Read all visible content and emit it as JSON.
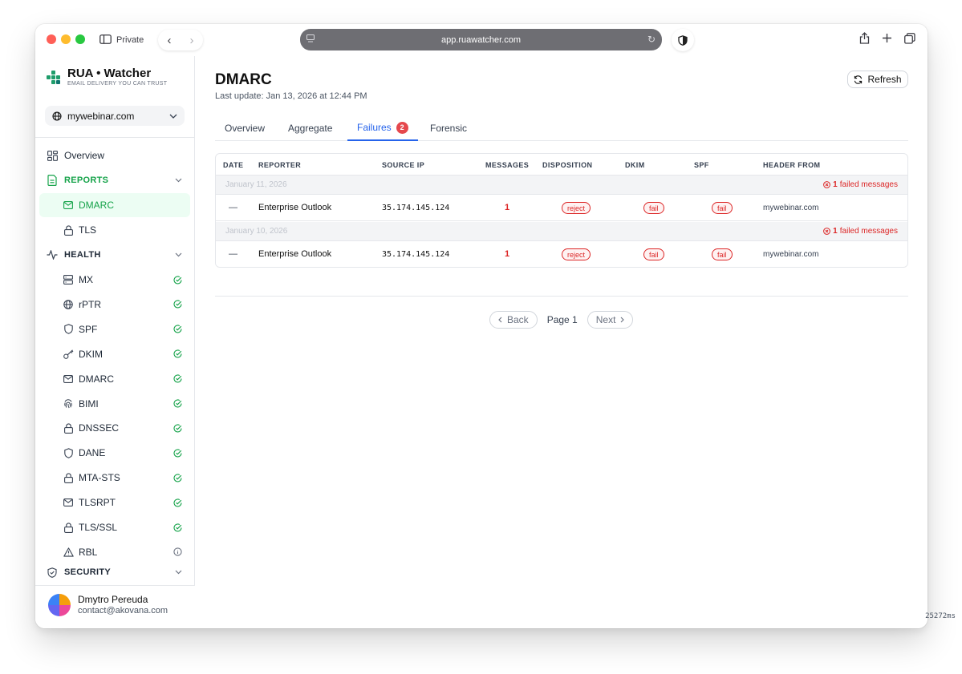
{
  "browser": {
    "private_label": "Private",
    "url": "app.ruawatcher.com"
  },
  "brand": {
    "name": "RUA • Watcher",
    "tagline": "EMAIL DELIVERY YOU CAN TRUST",
    "accent": "#16a34a"
  },
  "domain_select": {
    "value": "mywebinar.com"
  },
  "sidebar": {
    "overview": "Overview",
    "reports": "REPORTS",
    "dmarc_report": "DMARC",
    "tls_report": "TLS",
    "health": "HEALTH",
    "health_items": [
      {
        "label": "MX",
        "icon": "server-icon",
        "status": "ok"
      },
      {
        "label": "rPTR",
        "icon": "globe-icon",
        "status": "ok"
      },
      {
        "label": "SPF",
        "icon": "shield-icon",
        "status": "ok"
      },
      {
        "label": "DKIM",
        "icon": "key-icon",
        "status": "ok"
      },
      {
        "label": "DMARC",
        "icon": "mail-icon",
        "status": "ok"
      },
      {
        "label": "BIMI",
        "icon": "fingerprint-icon",
        "status": "ok"
      },
      {
        "label": "DNSSEC",
        "icon": "lock-icon",
        "status": "ok"
      },
      {
        "label": "DANE",
        "icon": "shield-icon",
        "status": "ok"
      },
      {
        "label": "MTA-STS",
        "icon": "lock-icon",
        "status": "ok"
      },
      {
        "label": "TLSRPT",
        "icon": "mail-icon",
        "status": "ok"
      },
      {
        "label": "TLS/SSL",
        "icon": "lock-icon",
        "status": "ok"
      },
      {
        "label": "RBL",
        "icon": "warning-icon",
        "status": "info"
      }
    ],
    "security": "SECURITY"
  },
  "user": {
    "name": "Dmytro Pereuda",
    "email": "contact@akovana.com"
  },
  "main": {
    "title": "DMARC",
    "last_update": "Last update: Jan 13, 2026 at 12:44 PM",
    "refresh_label": "Refresh",
    "tabs": [
      {
        "label": "Overview"
      },
      {
        "label": "Aggregate"
      },
      {
        "label": "Failures",
        "badge": "2"
      },
      {
        "label": "Forensic"
      }
    ],
    "active_tab": "Failures"
  },
  "table": {
    "headers": [
      "DATE",
      "REPORTER",
      "SOURCE IP",
      "MESSAGES",
      "DISPOSITION",
      "DKIM",
      "SPF",
      "HEADER FROM"
    ],
    "groups": [
      {
        "date": "January 11, 2026",
        "failed_count": "1",
        "failed_suffix": "failed messages",
        "row": {
          "date": "—",
          "reporter": "Enterprise Outlook",
          "source_ip": "35.174.145.124",
          "messages": "1",
          "disposition": "reject",
          "dkim": "fail",
          "spf": "fail",
          "header_from": "mywebinar.com"
        }
      },
      {
        "date": "January 10, 2026",
        "failed_count": "1",
        "failed_suffix": "failed messages",
        "row": {
          "date": "—",
          "reporter": "Enterprise Outlook",
          "source_ip": "35.174.145.124",
          "messages": "1",
          "disposition": "reject",
          "dkim": "fail",
          "spf": "fail",
          "header_from": "mywebinar.com"
        }
      }
    ]
  },
  "pagination": {
    "back": "Back",
    "page": "Page 1",
    "next": "Next"
  },
  "perf": "25272ms"
}
